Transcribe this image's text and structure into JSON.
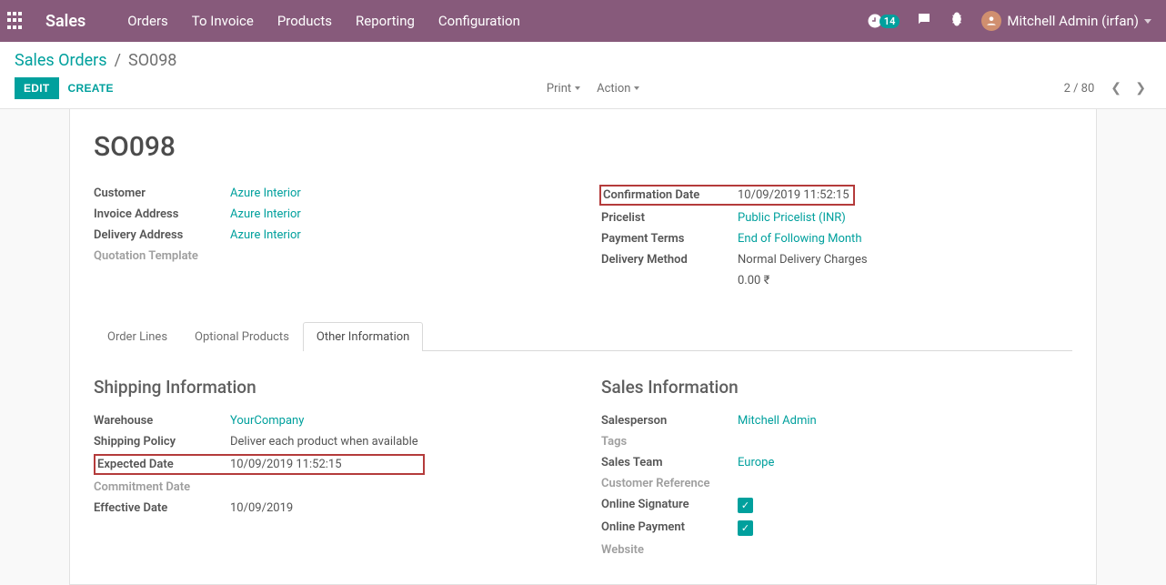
{
  "nav": {
    "brand": "Sales",
    "menu": [
      "Orders",
      "To Invoice",
      "Products",
      "Reporting",
      "Configuration"
    ],
    "badge_count": "14",
    "user_name": "Mitchell Admin (irfan)"
  },
  "breadcrumb": {
    "root": "Sales Orders",
    "current": "SO098"
  },
  "buttons": {
    "edit": "EDIT",
    "create": "CREATE"
  },
  "center_actions": {
    "print": "Print",
    "action": "Action"
  },
  "pager": {
    "position": "2 / 80"
  },
  "title": "SO098",
  "left_fields": {
    "customer_label": "Customer",
    "customer_value": "Azure Interior",
    "invoice_addr_label": "Invoice Address",
    "invoice_addr_value": "Azure Interior",
    "delivery_addr_label": "Delivery Address",
    "delivery_addr_value": "Azure Interior",
    "quotation_tmpl_label": "Quotation Template"
  },
  "right_fields": {
    "confirm_label": "Confirmation Date",
    "confirm_value": "10/09/2019 11:52:15",
    "pricelist_label": "Pricelist",
    "pricelist_value": "Public Pricelist (INR)",
    "payment_terms_label": "Payment Terms",
    "payment_terms_value": "End of Following Month",
    "delivery_method_label": "Delivery Method",
    "delivery_method_value": "Normal Delivery Charges",
    "delivery_cost_value": "0.00 ₹"
  },
  "tabs": {
    "order_lines": "Order Lines",
    "optional_products": "Optional Products",
    "other_info": "Other Information"
  },
  "shipping": {
    "heading": "Shipping Information",
    "warehouse_label": "Warehouse",
    "warehouse_value": "YourCompany",
    "policy_label": "Shipping Policy",
    "policy_value": "Deliver each product when available",
    "expected_label": "Expected Date",
    "expected_value": "10/09/2019 11:52:15",
    "commitment_label": "Commitment Date",
    "effective_label": "Effective Date",
    "effective_value": "10/09/2019"
  },
  "sales_info": {
    "heading": "Sales Information",
    "salesperson_label": "Salesperson",
    "salesperson_value": "Mitchell Admin",
    "tags_label": "Tags",
    "team_label": "Sales Team",
    "team_value": "Europe",
    "custref_label": "Customer Reference",
    "online_sig_label": "Online Signature",
    "online_pay_label": "Online Payment",
    "website_label": "Website"
  }
}
